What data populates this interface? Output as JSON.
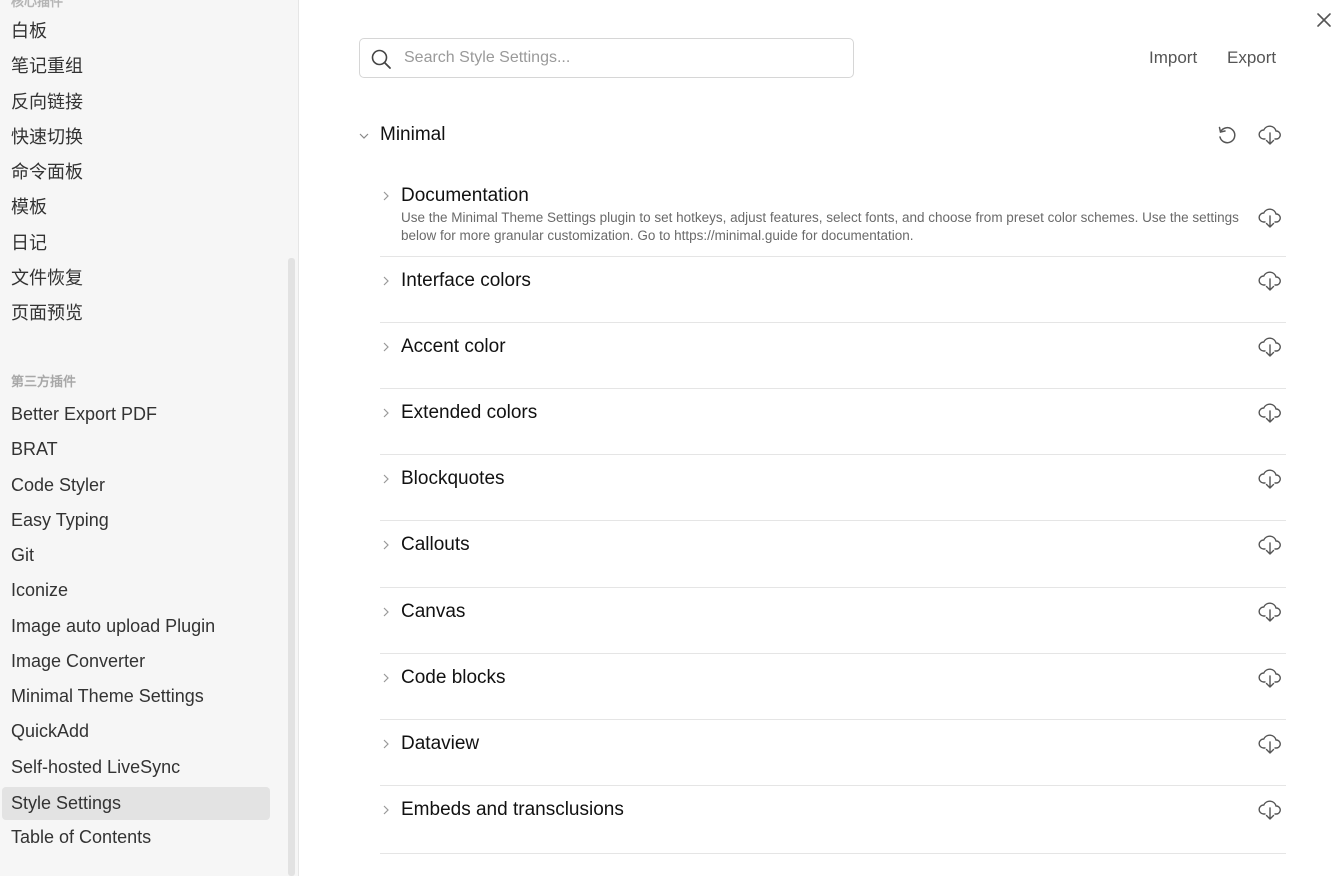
{
  "sidebar": {
    "partial_heading": "核心插件",
    "core_items": [
      "白板",
      "笔记重组",
      "反向链接",
      "快速切换",
      "命令面板",
      "模板",
      "日记",
      "文件恢复",
      "页面预览"
    ],
    "third_party_heading": "第三方插件",
    "third_party_items": [
      "Better Export PDF",
      "BRAT",
      "Code Styler",
      "Easy Typing",
      "Git",
      "Iconize",
      "Image auto upload Plugin",
      "Image Converter",
      "Minimal Theme Settings",
      "QuickAdd",
      "Self-hosted LiveSync",
      "Style Settings",
      "Table of Contents"
    ],
    "active_item": "Style Settings"
  },
  "search": {
    "placeholder": "Search Style Settings...",
    "value": ""
  },
  "header": {
    "import_label": "Import",
    "export_label": "Export"
  },
  "theme": {
    "name": "Minimal",
    "sections": [
      {
        "title": "Documentation",
        "description": "Use the Minimal Theme Settings plugin to set hotkeys, adjust features, select fonts, and choose from preset color schemes. Use the settings below for more granular customization. Go to https://minimal.guide for documentation."
      },
      {
        "title": "Interface colors"
      },
      {
        "title": "Accent color"
      },
      {
        "title": "Extended colors"
      },
      {
        "title": "Blockquotes"
      },
      {
        "title": "Callouts"
      },
      {
        "title": "Canvas"
      },
      {
        "title": "Code blocks"
      },
      {
        "title": "Dataview"
      },
      {
        "title": "Embeds and transclusions"
      }
    ]
  },
  "icons": {
    "close": "close-icon",
    "search": "search-icon",
    "reset": "reset-icon",
    "export": "download-cloud-icon",
    "collapse": "chevron-down-icon",
    "expand": "chevron-right-icon"
  }
}
